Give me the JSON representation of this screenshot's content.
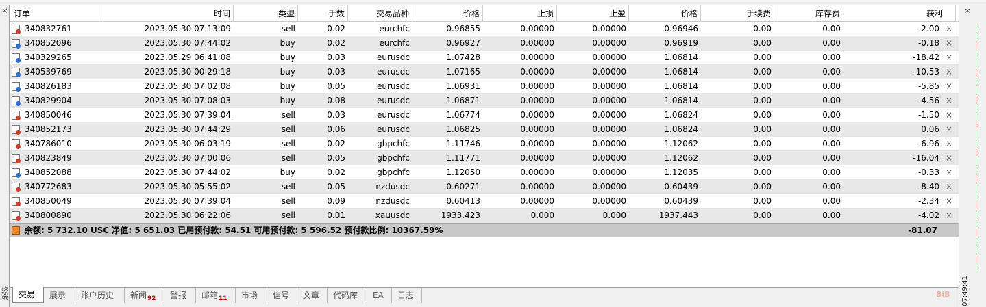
{
  "panel": {
    "close_glyph": "×",
    "vertical_label": "终端",
    "clock": "07:49:41"
  },
  "columns": [
    "订单",
    "时间",
    "类型",
    "手数",
    "交易品种",
    "价格",
    "止损",
    "止盈",
    "价格",
    "手续费",
    "库存费",
    "获利"
  ],
  "sort_indicator": "/",
  "orders": [
    {
      "id": "340832761",
      "time": "2023.05.30 07:13:09",
      "type": "sell",
      "lots": "0.02",
      "symbol": "eurchfc",
      "open_price": "0.96855",
      "sl": "0.00000",
      "tp": "0.00000",
      "price": "0.96946",
      "commission": "0.00",
      "swap": "0.00",
      "profit": "-2.00"
    },
    {
      "id": "340852096",
      "time": "2023.05.30 07:44:02",
      "type": "buy",
      "lots": "0.02",
      "symbol": "eurchfc",
      "open_price": "0.96927",
      "sl": "0.00000",
      "tp": "0.00000",
      "price": "0.96919",
      "commission": "0.00",
      "swap": "0.00",
      "profit": "-0.18"
    },
    {
      "id": "340329265",
      "time": "2023.05.29 06:41:08",
      "type": "buy",
      "lots": "0.03",
      "symbol": "eurusdc",
      "open_price": "1.07428",
      "sl": "0.00000",
      "tp": "0.00000",
      "price": "1.06814",
      "commission": "0.00",
      "swap": "0.00",
      "profit": "-18.42"
    },
    {
      "id": "340539769",
      "time": "2023.05.30 00:29:18",
      "type": "buy",
      "lots": "0.03",
      "symbol": "eurusdc",
      "open_price": "1.07165",
      "sl": "0.00000",
      "tp": "0.00000",
      "price": "1.06814",
      "commission": "0.00",
      "swap": "0.00",
      "profit": "-10.53"
    },
    {
      "id": "340826183",
      "time": "2023.05.30 07:02:08",
      "type": "buy",
      "lots": "0.05",
      "symbol": "eurusdc",
      "open_price": "1.06931",
      "sl": "0.00000",
      "tp": "0.00000",
      "price": "1.06814",
      "commission": "0.00",
      "swap": "0.00",
      "profit": "-5.85"
    },
    {
      "id": "340829904",
      "time": "2023.05.30 07:08:03",
      "type": "buy",
      "lots": "0.08",
      "symbol": "eurusdc",
      "open_price": "1.06871",
      "sl": "0.00000",
      "tp": "0.00000",
      "price": "1.06814",
      "commission": "0.00",
      "swap": "0.00",
      "profit": "-4.56"
    },
    {
      "id": "340850046",
      "time": "2023.05.30 07:39:04",
      "type": "sell",
      "lots": "0.03",
      "symbol": "eurusdc",
      "open_price": "1.06774",
      "sl": "0.00000",
      "tp": "0.00000",
      "price": "1.06824",
      "commission": "0.00",
      "swap": "0.00",
      "profit": "-1.50"
    },
    {
      "id": "340852173",
      "time": "2023.05.30 07:44:29",
      "type": "sell",
      "lots": "0.06",
      "symbol": "eurusdc",
      "open_price": "1.06825",
      "sl": "0.00000",
      "tp": "0.00000",
      "price": "1.06824",
      "commission": "0.00",
      "swap": "0.00",
      "profit": "0.06"
    },
    {
      "id": "340786010",
      "time": "2023.05.30 06:03:19",
      "type": "sell",
      "lots": "0.02",
      "symbol": "gbpchfc",
      "open_price": "1.11746",
      "sl": "0.00000",
      "tp": "0.00000",
      "price": "1.12062",
      "commission": "0.00",
      "swap": "0.00",
      "profit": "-6.96"
    },
    {
      "id": "340823849",
      "time": "2023.05.30 07:00:06",
      "type": "sell",
      "lots": "0.05",
      "symbol": "gbpchfc",
      "open_price": "1.11771",
      "sl": "0.00000",
      "tp": "0.00000",
      "price": "1.12062",
      "commission": "0.00",
      "swap": "0.00",
      "profit": "-16.04"
    },
    {
      "id": "340852088",
      "time": "2023.05.30 07:44:02",
      "type": "buy",
      "lots": "0.02",
      "symbol": "gbpchfc",
      "open_price": "1.12050",
      "sl": "0.00000",
      "tp": "0.00000",
      "price": "1.12035",
      "commission": "0.00",
      "swap": "0.00",
      "profit": "-0.33"
    },
    {
      "id": "340772683",
      "time": "2023.05.30 05:55:02",
      "type": "sell",
      "lots": "0.05",
      "symbol": "nzdusdc",
      "open_price": "0.60271",
      "sl": "0.00000",
      "tp": "0.00000",
      "price": "0.60439",
      "commission": "0.00",
      "swap": "0.00",
      "profit": "-8.40"
    },
    {
      "id": "340850049",
      "time": "2023.05.30 07:39:04",
      "type": "sell",
      "lots": "0.09",
      "symbol": "nzdusdc",
      "open_price": "0.60413",
      "sl": "0.00000",
      "tp": "0.00000",
      "price": "0.60439",
      "commission": "0.00",
      "swap": "0.00",
      "profit": "-2.34"
    },
    {
      "id": "340800890",
      "time": "2023.05.30 06:22:06",
      "type": "sell",
      "lots": "0.01",
      "symbol": "xauusdc",
      "open_price": "1933.423",
      "sl": "0.000",
      "tp": "0.000",
      "price": "1937.443",
      "commission": "0.00",
      "swap": "0.00",
      "profit": "-4.02"
    }
  ],
  "summary": {
    "text": "余额: 5 732.10 USC  净值: 5 651.03  已用预付款: 54.51  可用预付款: 5 596.52  预付款比例: 10367.59%",
    "total_profit": "-81.07"
  },
  "tabs": [
    {
      "label": "交易",
      "badge": "",
      "active": true
    },
    {
      "label": "展示",
      "badge": "",
      "active": false
    },
    {
      "label": "账户历史",
      "badge": "",
      "active": false
    },
    {
      "label": "新闻",
      "badge": "92",
      "active": false
    },
    {
      "label": "警报",
      "badge": "",
      "active": false
    },
    {
      "label": "邮箱",
      "badge": "11",
      "active": false
    },
    {
      "label": "市场",
      "badge": "",
      "active": false
    },
    {
      "label": "信号",
      "badge": "",
      "active": false
    },
    {
      "label": "文章",
      "badge": "",
      "active": false
    },
    {
      "label": "代码库",
      "badge": "",
      "active": false
    },
    {
      "label": "EA",
      "badge": "",
      "active": false
    },
    {
      "label": "日志",
      "badge": "",
      "active": false
    }
  ],
  "colors": {
    "buy_marker": "#2a6fd6",
    "sell_marker": "#d63a2a",
    "badge": "#c00000",
    "summary_bg": "#c8c8c8"
  }
}
